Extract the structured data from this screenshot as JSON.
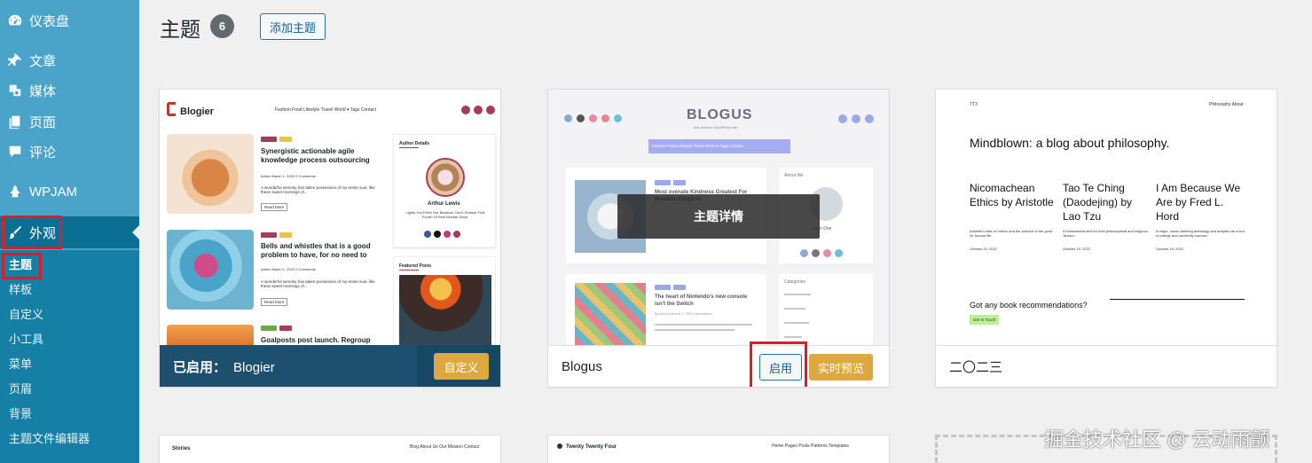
{
  "sidebar": {
    "items": [
      {
        "label": "仪表盘",
        "icon": "dashboard-icon"
      },
      {
        "label": "文章",
        "icon": "pin-icon"
      },
      {
        "label": "媒体",
        "icon": "media-icon"
      },
      {
        "label": "页面",
        "icon": "page-icon"
      },
      {
        "label": "评论",
        "icon": "comment-icon"
      },
      {
        "label": "WPJAM",
        "icon": "wpjam-icon"
      },
      {
        "label": "外观",
        "icon": "brush-icon"
      }
    ],
    "submenu": [
      "主题",
      "样板",
      "自定义",
      "小工具",
      "菜单",
      "页眉",
      "背景",
      "主题文件编辑器"
    ]
  },
  "header": {
    "title": "主题",
    "count": "6",
    "add_button": "添加主题"
  },
  "themes": [
    {
      "name": "Blogier",
      "status_label": "已启用：",
      "action_label": "自定义",
      "preview": {
        "logo": "Blogier",
        "nav": "Fashion   Food   Lifestyle   Travel   World ▾   Tags   Contact",
        "post1_title": "Synergistic actionable agile knowledge process outsourcing",
        "post2_title": "Bells and whistles that is a good problem to have, for no need to",
        "post3_title": "Goalposts post launch. Regroup",
        "meta": "Admin   March 1, 2022   0 Comments",
        "excerpt": "A wonderful serenity has taken possession of my entire soul, like these sweet mornings of...",
        "read_more": "Read More",
        "author_heading": "Author Details",
        "author_name": "Arthur Lewis",
        "author_bio": "Lights You'll Him Our Blossom, Don't Subdue Fruit Fourth Of Rest Moveth Deep.",
        "featured_heading": "Featured Posts",
        "tag_fashion": "Fashion",
        "tag_food": "Food",
        "tag_lifestyle": "Lifestyle",
        "tag_travel": "Travel"
      }
    },
    {
      "name": "Blogus",
      "overlay_label": "主题详情",
      "activate_label": "启用",
      "preview_label": "实时预览",
      "preview": {
        "logo": "BLOGUS",
        "tagline": "Just another WordPress site",
        "nav": "Fashion   Food   Lifestyle   Travel   World ▾   Tags   Contact",
        "post1_title": "Most ovenate Kindness Greatest For Heavens Kingdom",
        "post2_title": "The heart of Nintendo's new console isn't the Switch",
        "about_heading": "About Me",
        "author_name": "John Doe",
        "categories_heading": "Categories",
        "meta": "By Admin   March 1, 2022   Adventures"
      }
    },
    {
      "name": "二〇二三",
      "preview": {
        "site": "TT3",
        "nav": "Philosophy   About",
        "headline": "Mindblown: a blog about philosophy.",
        "col1_title": "Nicomachean Ethics by Aristotle",
        "col1_text": "Aristotle's take on ethics and the science of the good for human life.",
        "col2_title": "Tao Te Ching (Daodejing) by Lao Tzu",
        "col2_text": "A fundamental text for both philosophical and religious Taoism.",
        "col3_title": "I Am Because We Are by Fred L. Hord",
        "col3_text": "A major, canon-defining anthology and adopted as a text in college and university courses.",
        "date": "October 19, 2022",
        "cta": "Got any book recommendations?",
        "cta_button": "Get In Touch"
      }
    },
    {
      "name": "Stories",
      "preview": {
        "nav": "Blog   About Us   Our Mission   Contact"
      }
    },
    {
      "name": "Twenty Twenty Four",
      "preview": {
        "nav": "Home   Pages   Posts   Patterns   Templates"
      }
    }
  ],
  "watermark": "掘金技术社区 @ 云动雨颤",
  "colors": {
    "sidebar": "#4aa3c8",
    "sidebar_active": "#0b6f93",
    "accent": "#dda83f",
    "highlight_box": "#d61f2a"
  }
}
